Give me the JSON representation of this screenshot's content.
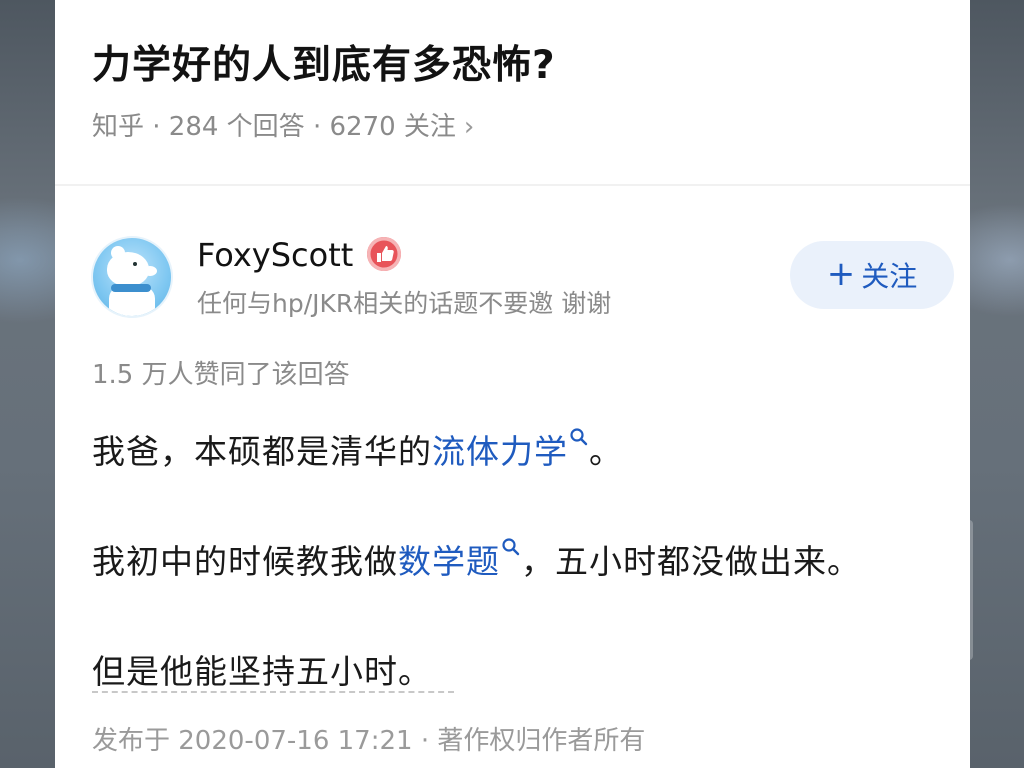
{
  "question": {
    "title": "力学好的人到底有多恐怖?",
    "meta": "知乎 · 284 个回答 · 6270 关注",
    "meta_chevron": "›"
  },
  "answer": {
    "author": {
      "name": "FoxyScott",
      "bio": "任何与hp/JKR相关的话题不要邀 谢谢",
      "badge_icon": "thumbs-up-badge-icon"
    },
    "follow_label": "关注",
    "follow_plus": "+",
    "votes": "1.5 万人赞同了该回答",
    "paragraphs": {
      "p1_before": "我爸，本硕都是清华的",
      "p1_link": "流体力学",
      "p1_after": "。",
      "p2_before": "我初中的时候教我做",
      "p2_link": "数学题",
      "p2_after": "，五小时都没做出来。",
      "p3": "但是他能坚持五小时。"
    },
    "published": "发布于 2020-07-16 17:21 · 著作权归作者所有"
  },
  "colors": {
    "link": "#1f5bbf",
    "muted": "#8a8a8a",
    "follow_bg": "#eaf1fb",
    "badge": "#e8545a"
  }
}
